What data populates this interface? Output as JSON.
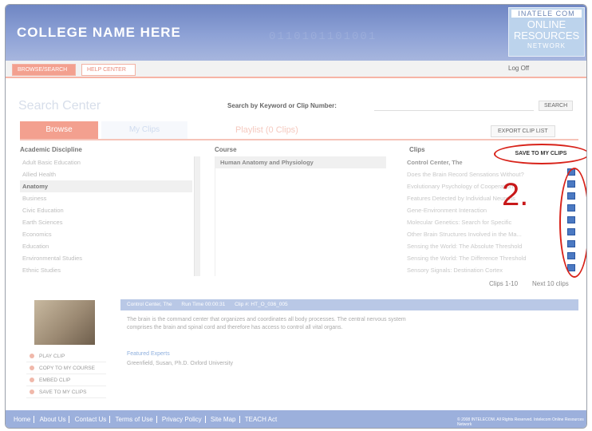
{
  "header": {
    "college_name": "COLLEGE NAME HERE",
    "logo_top": "INATELE COM",
    "logo_mid_1": "ONLINE",
    "logo_mid_2": "RESOURCES",
    "logo_bottom": "NETWORK"
  },
  "nav": {
    "active_tab": "BROWSE/SEARCH",
    "help_tab": "HELP CENTER",
    "logoff": "Log Off"
  },
  "search": {
    "title": "Search Center",
    "label": "Search by Keyword or Clip Number:",
    "input_value": "",
    "button": "SEARCH"
  },
  "tabs": {
    "browse": "Browse",
    "my_clips": "My Clips",
    "playlist": "Playlist (0 Clips)"
  },
  "export_button": "EXPORT CLIP LIST",
  "columns": {
    "discipline_header": "Academic Discipline",
    "course_header": "Course",
    "clips_header": "Clips"
  },
  "disciplines": [
    "Adult Basic Education",
    "Allied Health",
    "Anatomy",
    "Business",
    "Civic Education",
    "Earth Sciences",
    "Economics",
    "Education",
    "Environmental Studies",
    "Ethnic Studies"
  ],
  "selected_discipline_index": 2,
  "course": "Human Anatomy and Physiology",
  "clips": [
    "Control Center, The",
    "Does the Brain Record Sensations Without?",
    "Evolutionary Psychology of Cooperation",
    "Features Detected by Individual Neurons",
    "Gene-Environment Interaction",
    "Molecular Genetics: Search for Specific",
    "Other Brain Structures Involved in the Ma...",
    "Sensing the World: The Absolute Threshold",
    "Sensing the World: The Difference Threshold",
    "Sensory Signals: Destination Cortex"
  ],
  "save_to_my_clips": "SAVE TO MY CLIPS",
  "annotation": "2.",
  "pager": {
    "range": "Clips 1-10",
    "next": "Next 10 clips"
  },
  "detail": {
    "title": "Control Center, The",
    "run_time": "Run Time 00:00:31",
    "clip_id": "Clip #: HT_O_036_005",
    "description": "The brain is the command center that organizes and coordinates all body processes. The central nervous system comprises the brain and spinal cord and therefore has access to control all vital organs.",
    "expert_link": "Featured Experts",
    "expert_name": "Greenfield, Susan, Ph.D. Oxford University"
  },
  "clip_actions": [
    "PLAY CLIP",
    "COPY TO MY COURSE",
    "EMBED CLIP",
    "SAVE TO MY CLIPS"
  ],
  "footer": {
    "links": [
      "Home",
      "About Us",
      "Contact Us",
      "Terms of Use",
      "Privacy Policy",
      "Site Map",
      "TEACH Act"
    ],
    "copyright": "© 2008 INTELECOM. All Rights Reserved. Intelecom Online Resources Network"
  },
  "colors": {
    "header_blue": "#8ea2d6",
    "accent_salmon": "#f3a08f",
    "annotation_red": "#d8231a",
    "clip_icon_blue": "#4b79c2"
  }
}
